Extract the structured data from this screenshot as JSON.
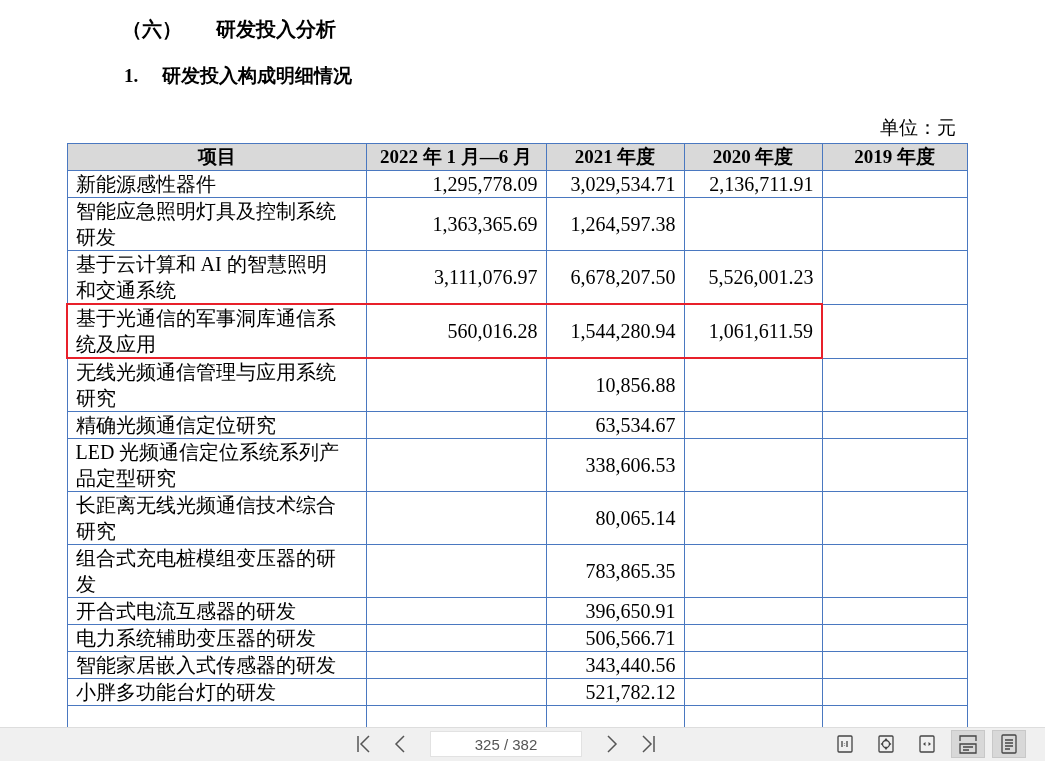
{
  "document": {
    "section_heading": "（六）",
    "section_title": "研发投入分析",
    "subheading_number": "1.",
    "subheading_title": "研发投入构成明细情况",
    "unit_note": "单位：元",
    "table": {
      "columns": [
        "项目",
        "2022 年 1 月—6 月",
        "2021 年度",
        "2020 年度",
        "2019 年度"
      ],
      "rows": [
        {
          "cells": [
            "新能源感性器件",
            "1,295,778.09",
            "3,029,534.71",
            "2,136,711.91",
            ""
          ],
          "highlighted": false
        },
        {
          "cells": [
            "智能应急照明灯具及控制系统研发",
            "1,363,365.69",
            "1,264,597.38",
            "",
            ""
          ],
          "highlighted": false
        },
        {
          "cells": [
            "基于云计算和 AI 的智慧照明和交通系统",
            "3,111,076.97",
            "6,678,207.50",
            "5,526,001.23",
            ""
          ],
          "highlighted": false
        },
        {
          "cells": [
            "基于光通信的军事洞库通信系统及应用",
            "560,016.28",
            "1,544,280.94",
            "1,061,611.59",
            ""
          ],
          "highlighted": true
        },
        {
          "cells": [
            "无线光频通信管理与应用系统研究",
            "",
            "10,856.88",
            "",
            ""
          ],
          "highlighted": false
        },
        {
          "cells": [
            "精确光频通信定位研究",
            "",
            "63,534.67",
            "",
            ""
          ],
          "highlighted": false
        },
        {
          "cells": [
            "LED 光频通信定位系统系列产品定型研究",
            "",
            "338,606.53",
            "",
            ""
          ],
          "highlighted": false
        },
        {
          "cells": [
            "长距离无线光频通信技术综合研究",
            "",
            "80,065.14",
            "",
            ""
          ],
          "highlighted": false
        },
        {
          "cells": [
            "组合式充电桩模组变压器的研发",
            "",
            "783,865.35",
            "",
            ""
          ],
          "highlighted": false
        },
        {
          "cells": [
            "开合式电流互感器的研发",
            "",
            "396,650.91",
            "",
            ""
          ],
          "highlighted": false
        },
        {
          "cells": [
            "电力系统辅助变压器的研发",
            "",
            "506,566.71",
            "",
            ""
          ],
          "highlighted": false
        },
        {
          "cells": [
            "智能家居嵌入式传感器的研发",
            "",
            "343,440.56",
            "",
            ""
          ],
          "highlighted": false
        },
        {
          "cells": [
            "小胖多功能台灯的研发",
            "",
            "521,782.12",
            "",
            ""
          ],
          "highlighted": false
        }
      ]
    }
  },
  "toolbar": {
    "page_field": {
      "value": "325 / 382"
    },
    "view_buttons": [
      {
        "kind": "actual-size",
        "selected": false
      },
      {
        "kind": "fit-page",
        "selected": false
      },
      {
        "kind": "fit-width",
        "selected": false
      },
      {
        "kind": "continuous",
        "selected": true
      },
      {
        "kind": "single-page",
        "selected": true
      }
    ]
  }
}
